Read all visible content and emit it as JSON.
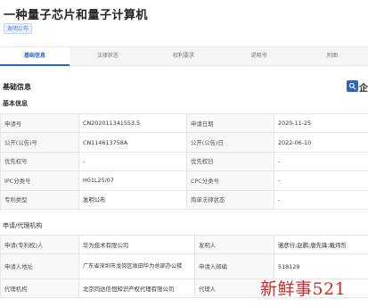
{
  "title": "一种量子芯片和量子计算机",
  "badge": "发明公布",
  "tabs": [
    {
      "label": "基础信息",
      "active": true
    },
    {
      "label": "法律状态",
      "active": false
    },
    {
      "label": "权利要求",
      "active": false
    },
    {
      "label": "说明书",
      "active": false
    },
    {
      "label": "附图",
      "active": false
    }
  ],
  "section_basic": "基础信息",
  "section_base": "基本信息",
  "section_applicant": "申请/代理机构",
  "tool_label": "企",
  "info_rows": [
    {
      "k1": "申请号",
      "v1": "CN202011341553.5",
      "k2": "申请日期",
      "v2": "2020-11-25"
    },
    {
      "k1": "公开(公告)号",
      "v1": "CN114613758A",
      "k2": "公开(公告)日",
      "v2": "2022-06-10"
    },
    {
      "k1": "优先权号",
      "v1": "-",
      "k2": "优先权日",
      "v2": "-"
    },
    {
      "k1": "IPC分类号",
      "v1": "H01L25/07",
      "k2": "CPC分类号",
      "v2": "-"
    },
    {
      "k1": "专利类型",
      "v1": "发明公布",
      "k2": "简单法律状态",
      "v2": "-"
    }
  ],
  "applicant": {
    "k_applicant": "申请(专利权)人",
    "v_applicant": "华为技术有限公司",
    "k_inventor": "发明人",
    "v_inventor": "骆彦行;赵鹏;唐先锋;戴炜哲",
    "k_address": "申请人地址",
    "v_address": "广东省深圳市龙岗区坂田华为总部办公楼",
    "k_postcode": "申请人邮编",
    "v_postcode": "518129",
    "k_agency": "代理机构",
    "v_agency": "北京同达信恒知识产权代理有限公司",
    "k_agent": "代理人",
    "v_agent": ""
  },
  "watermark": "新鲜事521",
  "colors": {
    "accent": "#2d66c2",
    "watermark": "#d22a2a"
  }
}
